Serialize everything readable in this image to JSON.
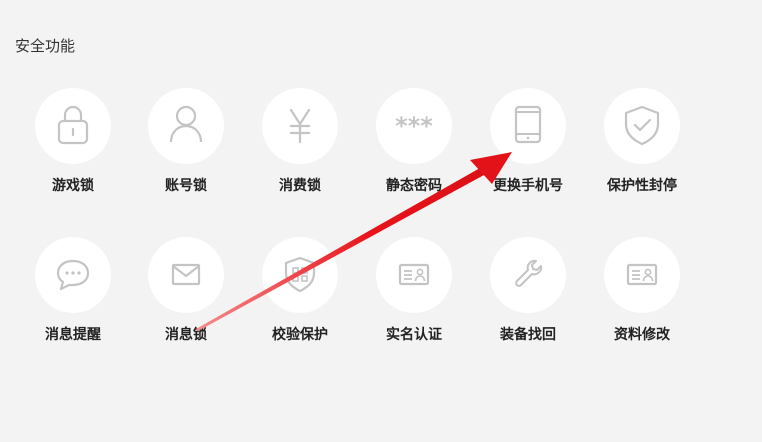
{
  "section": {
    "title": "安全功能"
  },
  "colors": {
    "background": "#f3f3f3",
    "icon_circle": "#ffffff",
    "icon_stroke": "#c4c4c4",
    "label_text": "#222222",
    "arrow": "#e8141a"
  },
  "features": [
    {
      "label": "游戏锁",
      "icon": "padlock-icon"
    },
    {
      "label": "账号锁",
      "icon": "user-icon"
    },
    {
      "label": "消费锁",
      "icon": "yen-icon"
    },
    {
      "label": "静态密码",
      "icon": "password-dots-icon"
    },
    {
      "label": "更换手机号",
      "icon": "mobile-phone-icon"
    },
    {
      "label": "保护性封停",
      "icon": "shield-check-icon"
    },
    {
      "label": "消息提醒",
      "icon": "chat-bubble-icon"
    },
    {
      "label": "消息锁",
      "icon": "envelope-icon"
    },
    {
      "label": "校验保护",
      "icon": "shield-grid-icon"
    },
    {
      "label": "实名认证",
      "icon": "id-card-icon"
    },
    {
      "label": "装备找回",
      "icon": "wrench-icon"
    },
    {
      "label": "资料修改",
      "icon": "profile-card-icon"
    }
  ],
  "annotation": {
    "type": "arrow",
    "from_feature": "消息锁",
    "to_feature": "更换手机号"
  }
}
